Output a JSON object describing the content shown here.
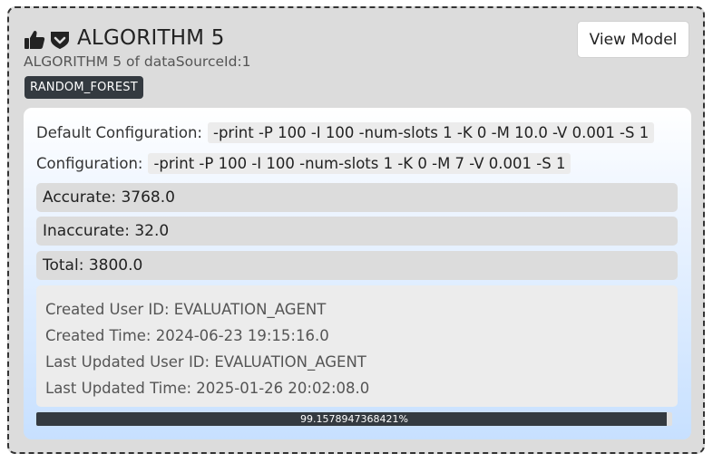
{
  "card": {
    "title": "ALGORITHM 5",
    "subtitle": "ALGORITHM 5 of dataSourceId:1",
    "badge": "RANDOM_FOREST",
    "view_button": "View Model",
    "icons": [
      "thumbs-up-icon",
      "shield-check-icon"
    ]
  },
  "details": {
    "default_config_label": "Default Configuration:",
    "default_config_value": "-print -P 100 -I 100 -num-slots 1 -K 0 -M 10.0 -V 0.001 -S 1",
    "config_label": "Configuration:",
    "config_value": "-print -P 100 -I 100 -num-slots 1 -K 0 -M 7 -V 0.001 -S 1",
    "accurate": "Accurate: 3768.0",
    "inaccurate": "Inaccurate: 32.0",
    "total": "Total: 3800.0",
    "created_user": "Created User ID: EVALUATION_AGENT",
    "created_time": "Created Time: 2024-06-23 19:15:16.0",
    "updated_user": "Last Updated User ID: EVALUATION_AGENT",
    "updated_time": "Last Updated Time: 2025-01-26 20:02:08.0"
  },
  "progress": {
    "percent": 99.1578947368421,
    "label": "99.1578947368421%"
  },
  "colors": {
    "card_bg": "#dcdcdc",
    "badge_bg": "#343a40",
    "progress_fill": "#343a40"
  }
}
